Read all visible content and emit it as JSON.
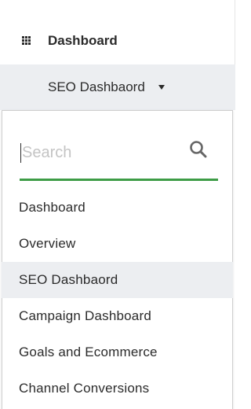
{
  "header": {
    "title": "Dashboard",
    "icon": "grid-icon"
  },
  "selector": {
    "current": "SEO Dashbaord",
    "icon": "caret-down-icon"
  },
  "dropdown": {
    "search": {
      "placeholder": "Search",
      "value": "",
      "icon": "search-icon",
      "accent_color": "#3d9c46"
    },
    "items": [
      {
        "label": "Dashboard",
        "selected": false
      },
      {
        "label": "Overview",
        "selected": false
      },
      {
        "label": "SEO Dashbaord",
        "selected": true
      },
      {
        "label": "Campaign Dashboard",
        "selected": false
      },
      {
        "label": "Goals and Ecommerce",
        "selected": false
      },
      {
        "label": "Channel Conversions",
        "selected": false
      }
    ]
  },
  "colors": {
    "selected_bg": "#eceef1",
    "text": "#2b2b2b"
  }
}
